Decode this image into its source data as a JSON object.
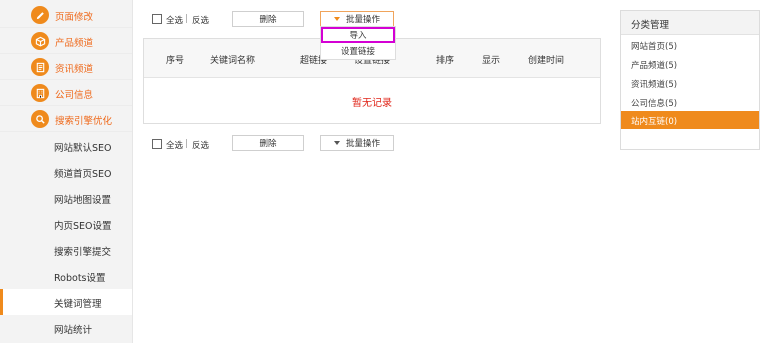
{
  "sidebar": {
    "sections": [
      {
        "label": "页面修改",
        "icon": "pencil-icon"
      },
      {
        "label": "产品频道",
        "icon": "box-icon"
      },
      {
        "label": "资讯频道",
        "icon": "document-icon"
      },
      {
        "label": "公司信息",
        "icon": "building-icon"
      },
      {
        "label": "搜索引擎优化",
        "icon": "search-icon"
      }
    ],
    "sub_items": [
      "网站默认SEO",
      "频道首页SEO",
      "网站地图设置",
      "内页SEO设置",
      "搜索引擎提交",
      "Robots设置",
      "关键词管理",
      "网站统计"
    ],
    "active_sub": "关键词管理"
  },
  "toolbar_top": {
    "select_all": "全选",
    "separator": "|",
    "invert": "反选",
    "delete": "删除",
    "batch": "批量操作"
  },
  "dropdown": {
    "import": "导入",
    "set_link": "设置链接"
  },
  "table": {
    "columns": [
      "序号",
      "关键词名称",
      "超链接",
      "设置链接",
      "排序",
      "显示",
      "创建时间"
    ],
    "empty_text": "暂无记录"
  },
  "toolbar_bottom": {
    "select_all": "全选",
    "separator": "|",
    "invert": "反选",
    "delete": "删除",
    "batch": "批量操作"
  },
  "categories": {
    "title": "分类管理",
    "items": [
      "网站首页(5)",
      "产品频道(5)",
      "资讯频道(5)",
      "公司信息(5)",
      "站内互链(0)"
    ],
    "active": "站内互链(0)"
  },
  "colors": {
    "accent": "#ef8a1c",
    "empty_text": "#e0261a",
    "highlight": "#d400d4"
  }
}
